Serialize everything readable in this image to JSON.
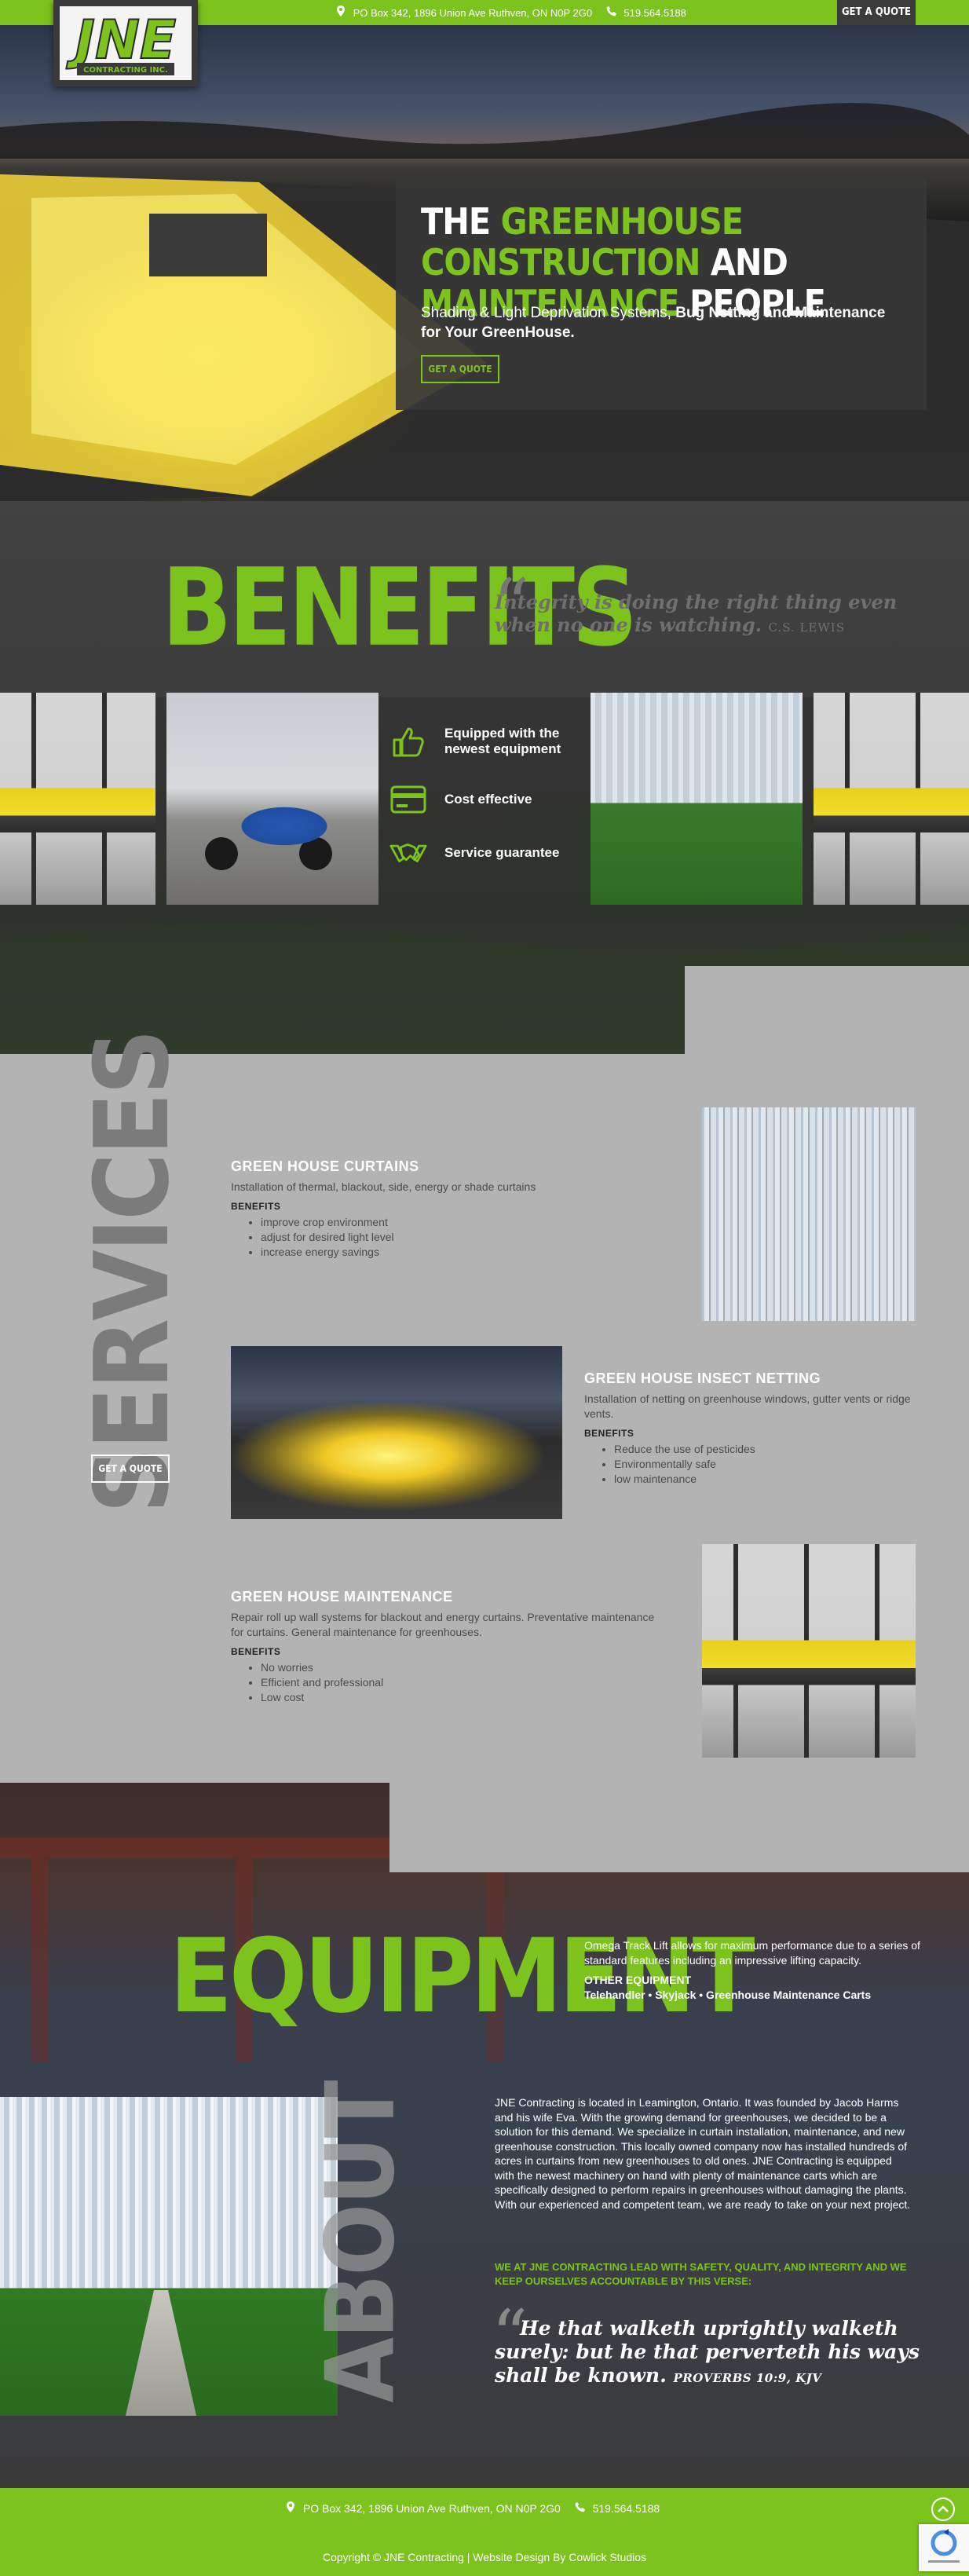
{
  "topbar": {
    "address": "PO Box 342, 1896 Union Ave Ruthven, ON N0P 2G0",
    "phone": "519.564.5188",
    "quote_button": "GET A QUOTE"
  },
  "logo": {
    "letters": "JNE",
    "subtitle": "CONTRACTING INC."
  },
  "hero": {
    "title_pre": "THE",
    "title_green": "GREENHOUSE CONSTRUCTION",
    "title_mid": "AND",
    "title_green2": "MAINTENANCE",
    "title_end": "PEOPLE",
    "sub_plain": "Shading & Light Deprivation Systems,",
    "sub_bold": "Bug Netting and Maintenance for Your GreenHouse.",
    "button": "GET A QUOTE"
  },
  "benefits": {
    "title": "BENEFITS",
    "quote": "Integrity is doing the right thing even when no one is watching.",
    "quote_author": "C.S. LEWIS",
    "features": [
      {
        "label": "Equipped with the newest equipment",
        "icon": "thumbs-up-icon"
      },
      {
        "label": "Cost effective",
        "icon": "credit-card-icon"
      },
      {
        "label": "Service guarantee",
        "icon": "handshake-icon"
      }
    ]
  },
  "services": {
    "title": "SERVICES",
    "button": "GET A QUOTE",
    "items": [
      {
        "title": "GREEN HOUSE CURTAINS",
        "desc": "Installation of thermal, blackout, side, energy or shade curtains",
        "benefits_label": "BENEFITS",
        "benefits": [
          "improve crop environment",
          "adjust for desired light level",
          "increase energy savings"
        ]
      },
      {
        "title": "GREEN HOUSE INSECT NETTING",
        "desc": "Installation of netting on greenhouse windows, gutter vents or ridge vents.",
        "benefits_label": "BENEFITS",
        "benefits": [
          "Reduce the use of pesticides",
          "Environmentally safe",
          "low maintenance"
        ]
      },
      {
        "title": "GREEN HOUSE MAINTENANCE",
        "desc": "Repair roll up wall systems for blackout and energy curtains. Preventative maintenance for curtains. General maintenance for greenhouses.",
        "benefits_label": "BENEFITS",
        "benefits": [
          "No worries",
          "Efficient and professional",
          "Low cost"
        ]
      }
    ]
  },
  "equipment": {
    "title": "EQUIPMENT",
    "desc": "Omega Track Lift allows for maximum performance due to a series of standard features including an impressive lifting capacity.",
    "other_label": "OTHER EQUIPMENT",
    "other_list": "Telehandler • Skyjack • Greenhouse Maintenance Carts"
  },
  "about": {
    "title": "ABOUT",
    "text": "JNE Contracting is located in Leamington, Ontario. It was founded by Jacob Harms and his wife Eva. With the growing demand for greenhouses, we decided to be a solution for this demand. We specialize in curtain installation, maintenance, and new greenhouse construction. This locally owned company now has installed hundreds of acres in curtains from new greenhouses to old ones. JNE Contracting is equipped with the newest machinery on hand with plenty of maintenance carts which are specifically designed to perform repairs in greenhouses without damaging the plants. With our experienced and competent team, we are ready to take on your next project.",
    "lead": "WE AT JNE CONTRACTING LEAD WITH SAFETY, QUALITY, AND INTEGRITY AND WE KEEP OURSELVES ACCOUNTABLE BY THIS VERSE:",
    "verse": "He that walketh uprightly walketh surely: but he that perverteth his ways shall be known.",
    "verse_ref": "PROVERBS 10:9, KJV"
  },
  "footer": {
    "address": "PO Box 342, 1896 Union Ave Ruthven, ON N0P 2G0",
    "phone": "519.564.5188",
    "copyright": "Copyright © JNE Contracting | Website Design By Cowlick Studios"
  },
  "colors": {
    "brand_green": "#7dc31e",
    "dark_panel": "#3a3a3a",
    "services_bg": "#b3b3b3"
  }
}
